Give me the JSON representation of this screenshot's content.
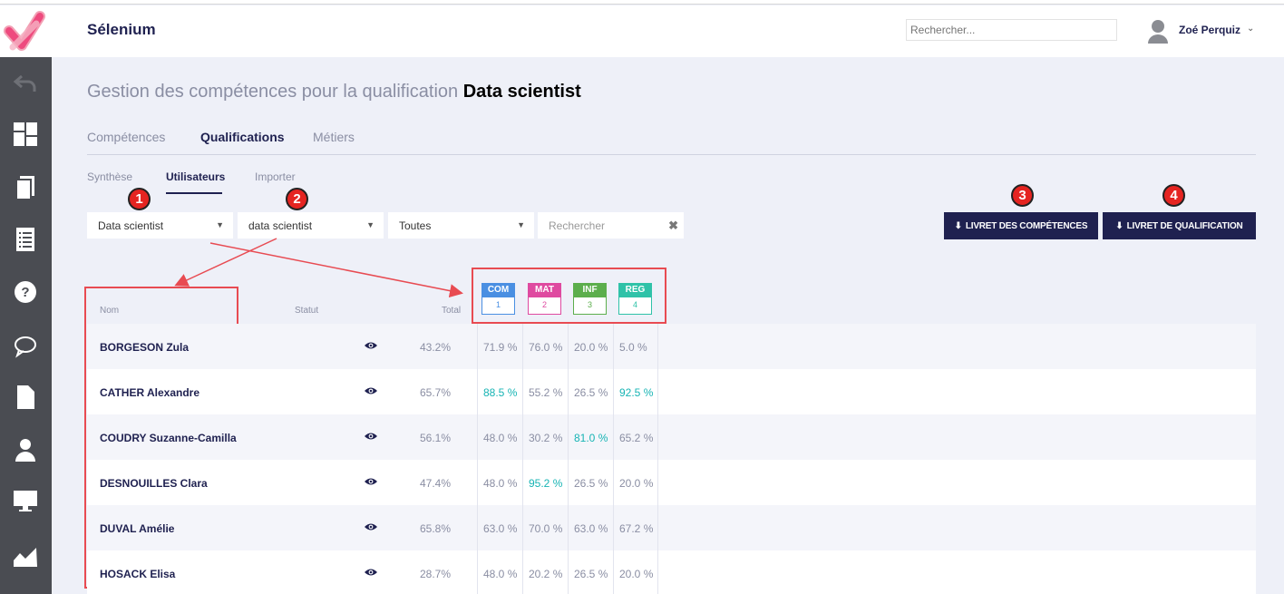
{
  "app": {
    "title": "Sélenium"
  },
  "header": {
    "search_placeholder": "Rechercher...",
    "user_name": "Zoé Perquiz"
  },
  "sidebar": {
    "icons": [
      "back-icon",
      "dashboard-icon",
      "copy-icon",
      "list-icon",
      "help-icon",
      "chat-icon",
      "document-icon",
      "user-icon",
      "monitor-icon",
      "chart-icon"
    ]
  },
  "page": {
    "title_prefix": "Gestion des compétences pour la qualification",
    "title_bold": "Data scientist"
  },
  "tabs": [
    {
      "label": "Compétences",
      "active": false
    },
    {
      "label": "Qualifications",
      "active": true
    },
    {
      "label": "Métiers",
      "active": false
    }
  ],
  "subtabs": [
    {
      "label": "Synthèse",
      "active": false
    },
    {
      "label": "Utilisateurs",
      "active": true
    },
    {
      "label": "Importer",
      "active": false
    }
  ],
  "filters": {
    "select1": "Data scientist",
    "select2": "data scientist",
    "select3": "Toutes",
    "search_placeholder": "Rechercher"
  },
  "buttons": {
    "livret_competences": "LIVRET DES COMPÉTENCES",
    "livret_qualification": "LIVRET DE QUALIFICATION"
  },
  "annotations": [
    "1",
    "2",
    "3",
    "4"
  ],
  "table": {
    "headers": {
      "nom": "Nom",
      "statut": "Statut",
      "total": "Total"
    },
    "categories": [
      {
        "code": "COM",
        "num": "1",
        "color": "#4a8fe2"
      },
      {
        "code": "MAT",
        "num": "2",
        "color": "#df4aa0"
      },
      {
        "code": "INF",
        "num": "3",
        "color": "#5cae4c"
      },
      {
        "code": "REG",
        "num": "4",
        "color": "#2fc2a8"
      }
    ],
    "rows": [
      {
        "name": "BORGESON Zula",
        "total": "43.2%",
        "scores": [
          "71.9 %",
          "76.0 %",
          "20.0 %",
          "5.0 %"
        ]
      },
      {
        "name": "CATHER Alexandre",
        "total": "65.7%",
        "scores": [
          "88.5 %",
          "55.2 %",
          "26.5 %",
          "92.5 %"
        ]
      },
      {
        "name": "COUDRY Suzanne-Camilla",
        "total": "56.1%",
        "scores": [
          "48.0 %",
          "30.2 %",
          "81.0 %",
          "65.2 %"
        ]
      },
      {
        "name": "DESNOUILLES Clara",
        "total": "47.4%",
        "scores": [
          "48.0 %",
          "95.2 %",
          "26.5 %",
          "20.0 %"
        ]
      },
      {
        "name": "DUVAL Amélie",
        "total": "65.8%",
        "scores": [
          "63.0 %",
          "70.0 %",
          "63.0 %",
          "67.2 %"
        ]
      },
      {
        "name": "HOSACK Elisa",
        "total": "28.7%",
        "scores": [
          "48.0 %",
          "20.2 %",
          "26.5 %",
          "20.0 %"
        ]
      }
    ]
  }
}
